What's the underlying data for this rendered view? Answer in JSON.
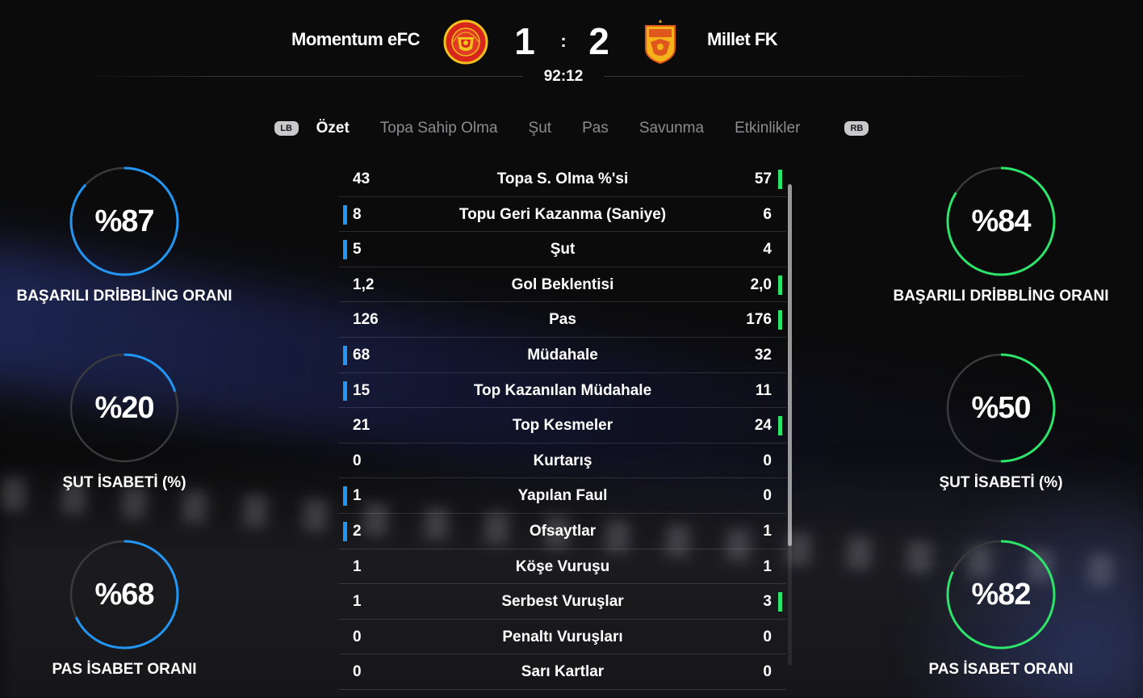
{
  "match": {
    "home_team": "Momentum eFC",
    "away_team": "Millet FK",
    "home_score": "1",
    "away_score": "2",
    "score_separator": ":",
    "clock": "92:12"
  },
  "tabs": {
    "left_bumper": "LB",
    "right_bumper": "RB",
    "items": [
      "Özet",
      "Topa Sahip Olma",
      "Şut",
      "Pas",
      "Savunma",
      "Etkinlikler"
    ],
    "active": "Özet"
  },
  "colors": {
    "home_accent": "#2196f3",
    "away_accent": "#2ee36a",
    "ring_track": "#3a3a3e"
  },
  "home_circles": [
    {
      "value_text": "%87",
      "value": 87,
      "label": "BAŞARILI DRİBBLİNG ORANI"
    },
    {
      "value_text": "%20",
      "value": 20,
      "label": "ŞUT İSABETİ (%)"
    },
    {
      "value_text": "%68",
      "value": 68,
      "label": "PAS İSABET ORANI"
    }
  ],
  "away_circles": [
    {
      "value_text": "%84",
      "value": 84,
      "label": "BAŞARILI DRİBBLİNG ORANI"
    },
    {
      "value_text": "%50",
      "value": 50,
      "label": "ŞUT İSABETİ (%)"
    },
    {
      "value_text": "%82",
      "value": 82,
      "label": "PAS İSABET ORANI"
    }
  ],
  "stats": [
    {
      "name": "Topa S. Olma %'si",
      "home": "43",
      "away": "57",
      "leader": "away"
    },
    {
      "name": "Topu Geri Kazanma (Saniye)",
      "home": "8",
      "away": "6",
      "leader": "home"
    },
    {
      "name": "Şut",
      "home": "5",
      "away": "4",
      "leader": "home"
    },
    {
      "name": "Gol Beklentisi",
      "home": "1,2",
      "away": "2,0",
      "leader": "away"
    },
    {
      "name": "Pas",
      "home": "126",
      "away": "176",
      "leader": "away"
    },
    {
      "name": "Müdahale",
      "home": "68",
      "away": "32",
      "leader": "home"
    },
    {
      "name": "Top Kazanılan Müdahale",
      "home": "15",
      "away": "11",
      "leader": "home"
    },
    {
      "name": "Top Kesmeler",
      "home": "21",
      "away": "24",
      "leader": "away"
    },
    {
      "name": "Kurtarış",
      "home": "0",
      "away": "0",
      "leader": "none"
    },
    {
      "name": "Yapılan Faul",
      "home": "1",
      "away": "0",
      "leader": "home"
    },
    {
      "name": "Ofsaytlar",
      "home": "2",
      "away": "1",
      "leader": "home"
    },
    {
      "name": "Köşe Vuruşu",
      "home": "1",
      "away": "1",
      "leader": "none"
    },
    {
      "name": "Serbest Vuruşlar",
      "home": "1",
      "away": "3",
      "leader": "away"
    },
    {
      "name": "Penaltı Vuruşları",
      "home": "0",
      "away": "0",
      "leader": "none"
    },
    {
      "name": "Sarı Kartlar",
      "home": "0",
      "away": "0",
      "leader": "none"
    }
  ]
}
